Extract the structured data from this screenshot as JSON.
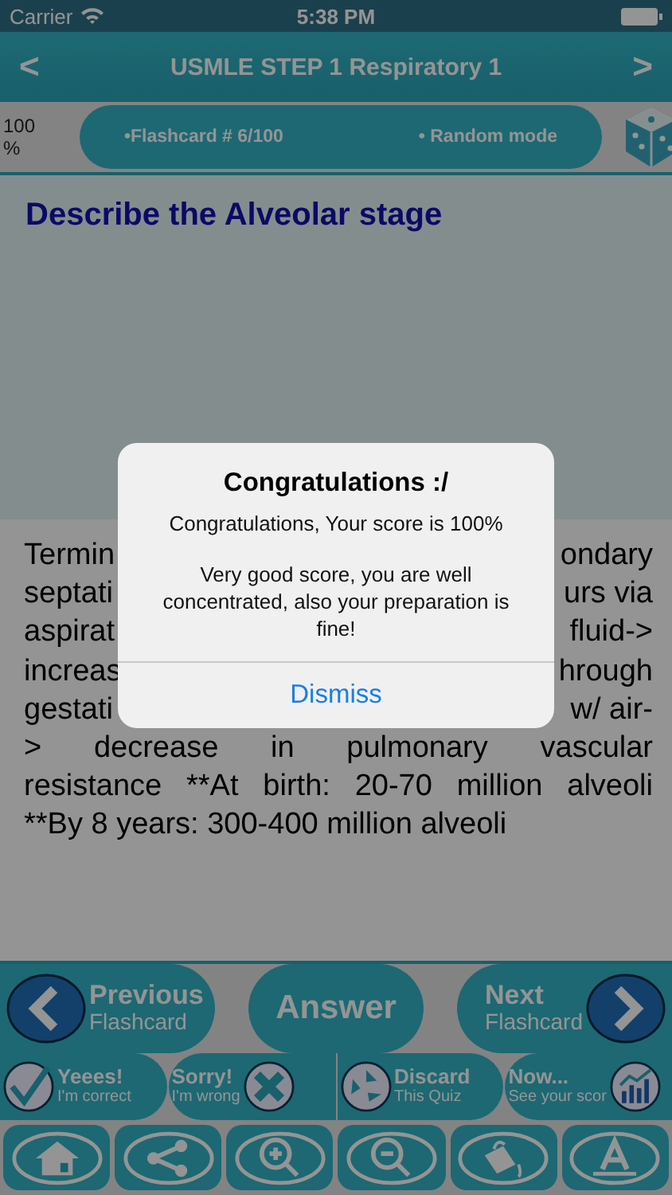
{
  "status_bar": {
    "carrier": "Carrier",
    "time": "5:38 PM"
  },
  "nav": {
    "back": "<",
    "title": "USMLE STEP 1 Respiratory 1",
    "forward": ">"
  },
  "progress": {
    "percent": "100 %",
    "flashcard": "•Flashcard #  6/100",
    "mode": "• Random mode"
  },
  "question": "Describe the Alveolar stage",
  "answer_lines": [
    {
      "kind": "split",
      "left": "Termin",
      "right": "ondary"
    },
    {
      "kind": "split",
      "left": "septati",
      "right": "urs via"
    },
    {
      "kind": "split",
      "left": "aspirat",
      "right": "fluid->"
    },
    {
      "kind": "split",
      "left": "increas",
      "right": "hrough"
    },
    {
      "kind": "split",
      "left": "gestati",
      "right": "w/ air-"
    },
    {
      "kind": "justified",
      "text": "> decrease in pulmonary vascular"
    },
    {
      "kind": "justified",
      "text": "resistance   **At birth: 20-70 million alveoli"
    },
    {
      "kind": "plain",
      "text": "**By 8 years: 300-400 million alveoli"
    }
  ],
  "nav_buttons": [
    {
      "kind": "prev",
      "title": "Previous",
      "subtitle": "Flashcard"
    },
    {
      "kind": "answer",
      "title": "Answer"
    },
    {
      "kind": "next",
      "title": "Next",
      "subtitle": "Flashcard"
    }
  ],
  "mark_buttons": [
    {
      "kind": "correct",
      "title": "Yeees!",
      "subtitle": "I'm correct"
    },
    {
      "kind": "wrong",
      "title": "Sorry!",
      "subtitle": "I'm wrong"
    },
    {
      "kind": "discard",
      "title": "Discard",
      "subtitle": "This Quiz"
    },
    {
      "kind": "score",
      "title": "Now...",
      "subtitle": "See your scor"
    }
  ],
  "toolbar": [
    {
      "kind": "home"
    },
    {
      "kind": "share"
    },
    {
      "kind": "zoom-in"
    },
    {
      "kind": "zoom-out"
    },
    {
      "kind": "bucket"
    },
    {
      "kind": "font"
    }
  ],
  "alert": {
    "title": "Congratulations :/",
    "message": "Congratulations, Your score is 100%",
    "detail": "Very good score, you are well concentrated, also your preparation is fine!",
    "button": "Dismiss"
  }
}
